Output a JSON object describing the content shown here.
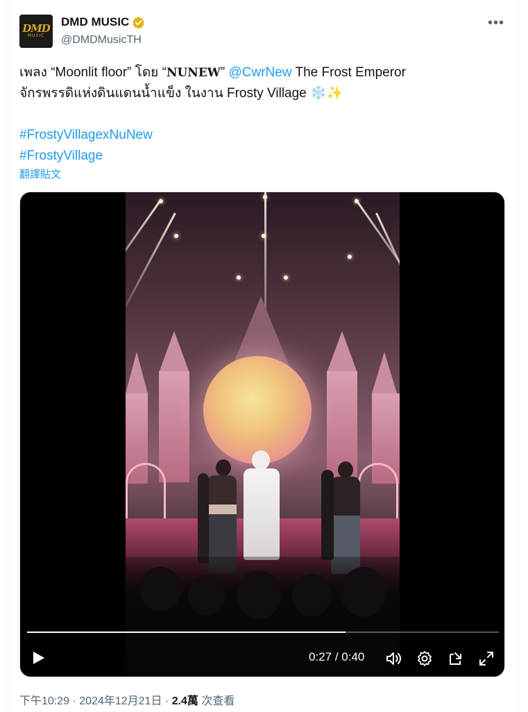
{
  "account": {
    "avatar_line1": "DMD",
    "avatar_line2": "MUSIC",
    "display_name": "DMD MUSIC",
    "handle": "@DMDMusicTH",
    "verified": true,
    "verified_color": "#f4b400"
  },
  "menu": {
    "more_label": "•••"
  },
  "tweet": {
    "line1_prefix": "เพลง “Moonlit floor” โดย “",
    "line1_bold": "NUNEW",
    "line1_close": "” ",
    "line1_mention": "@CwrNew",
    "line1_suffix": " The Frost Emperor",
    "line2_text": "จักรพรรดิแห่งดินแดนน้ำแข็ง ในงาน Frosty Village ",
    "line2_emoji": "❄️✨",
    "hashtag1": "#FrostyVillagexNuNew",
    "hashtag2": "#FrostyVillage",
    "translate_label": "翻譯貼文"
  },
  "video": {
    "progress_fraction": 0.675,
    "current_time": "0:27",
    "separator": " / ",
    "duration": "0:40",
    "icons": [
      "play-icon",
      "volume-icon",
      "settings-icon",
      "pop-out-icon",
      "fullscreen-icon"
    ]
  },
  "meta": {
    "time": "下午10:29",
    "dot": " · ",
    "date": "2024年12月21日",
    "views_count": "2.4萬",
    "views_label": " 次查看"
  },
  "colors": {
    "accent": "#1d9bf0",
    "secondary_text": "#536471",
    "primary_text": "#0f1419"
  }
}
